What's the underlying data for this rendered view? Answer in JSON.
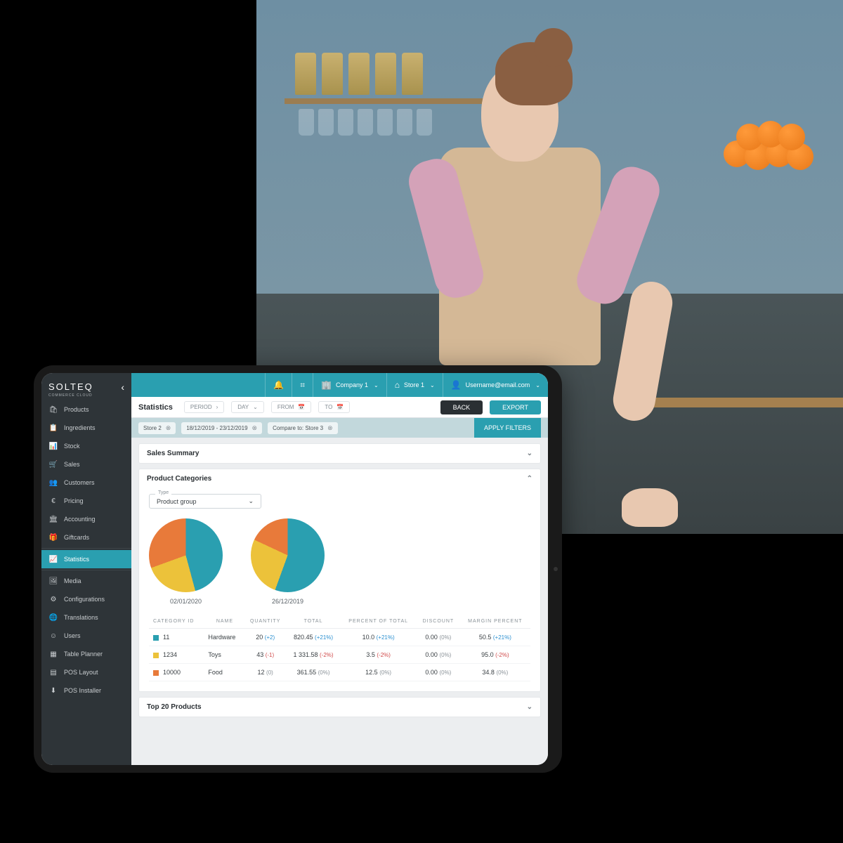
{
  "brand": {
    "name": "SOLTEQ",
    "sub": "COMMERCE CLOUD"
  },
  "sidebar": {
    "items": [
      {
        "label": "Products"
      },
      {
        "label": "Ingredients"
      },
      {
        "label": "Stock"
      },
      {
        "label": "Sales"
      },
      {
        "label": "Customers"
      },
      {
        "label": "Pricing"
      },
      {
        "label": "Accounting"
      },
      {
        "label": "Giftcards"
      },
      {
        "label": "Statistics"
      },
      {
        "label": "Media"
      },
      {
        "label": "Configurations"
      },
      {
        "label": "Translations"
      },
      {
        "label": "Users"
      },
      {
        "label": "Table Planner"
      },
      {
        "label": "POS Layout"
      },
      {
        "label": "POS Installer"
      }
    ]
  },
  "topbar": {
    "company": "Company 1",
    "store": "Store 1",
    "user": "Username@email.com"
  },
  "toolbar": {
    "title": "Statistics",
    "period": "PERIOD",
    "day": "DAY",
    "from": "FROM",
    "to": "TO",
    "back": "BACK",
    "export": "EXPORT"
  },
  "chips": {
    "c1": "Store 2",
    "c2": "18/12/2019 - 23/12/2019",
    "c3": "Compare to: Store 3",
    "apply": "APPLY FILTERS"
  },
  "panels": {
    "sales_summary": "Sales Summary",
    "product_categories": "Product Categories",
    "top20": "Top 20 Products"
  },
  "type": {
    "label": "Type",
    "value": "Product group"
  },
  "pies": {
    "date1": "02/01/2020",
    "date2": "26/12/2019"
  },
  "table": {
    "headers": {
      "cat": "CATEGORY ID",
      "name": "NAME",
      "qty": "QUANTITY",
      "total": "TOTAL",
      "pot": "PERCENT OF TOTAL",
      "disc": "DISCOUNT",
      "margin": "MARGIN PERCENT"
    },
    "rows": [
      {
        "color": "#2a9fb0",
        "id": "11",
        "name": "Hardware",
        "qty": "20",
        "qty_d": "(+2)",
        "total": "820.45",
        "total_d": "(+21%)",
        "pot": "10.0",
        "pot_d": "(+21%)",
        "disc": "0.00",
        "disc_d": "(0%)",
        "margin": "50.5",
        "margin_d": "(+21%)",
        "dc": "pos"
      },
      {
        "color": "#ecc23a",
        "id": "1234",
        "name": "Toys",
        "qty": "43",
        "qty_d": "(-1)",
        "total": "1 331.58",
        "total_d": "(-2%)",
        "pot": "3.5",
        "pot_d": "(-2%)",
        "disc": "0.00",
        "disc_d": "(0%)",
        "margin": "95.0",
        "margin_d": "(-2%)",
        "dc": "neg"
      },
      {
        "color": "#e87a3a",
        "id": "10000",
        "name": "Food",
        "qty": "12",
        "qty_d": "(0)",
        "total": "361.55",
        "total_d": "(0%)",
        "pot": "12.5",
        "pot_d": "(0%)",
        "disc": "0.00",
        "disc_d": "(0%)",
        "margin": "34.8",
        "margin_d": "(0%)",
        "dc": "zero"
      }
    ]
  },
  "chart_data": [
    {
      "type": "pie",
      "title": "02/01/2020",
      "categories": [
        "Hardware",
        "Toys",
        "Food"
      ],
      "values": [
        46,
        24,
        30
      ]
    },
    {
      "type": "pie",
      "title": "26/12/2019",
      "categories": [
        "Hardware",
        "Toys",
        "Food"
      ],
      "values": [
        56,
        26,
        18
      ]
    }
  ]
}
